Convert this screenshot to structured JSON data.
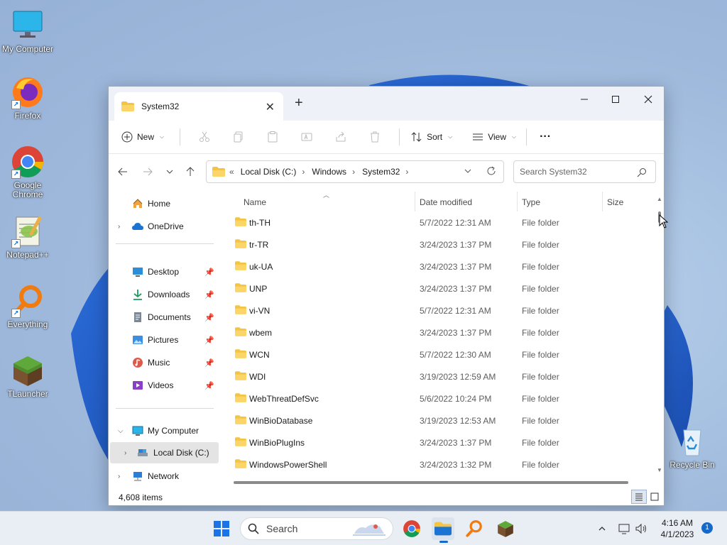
{
  "desktop": {
    "icons": [
      {
        "label": "My Computer"
      },
      {
        "label": "Firefox"
      },
      {
        "label": "Google Chrome"
      },
      {
        "label": "Notepad++"
      },
      {
        "label": "Everything"
      },
      {
        "label": "TLauncher"
      },
      {
        "label": "Recycle Bin"
      }
    ]
  },
  "window": {
    "tab_title": "System32",
    "toolbar": {
      "new_label": "New",
      "sort_label": "Sort",
      "view_label": "View",
      "more_label": "···"
    },
    "breadcrumb": {
      "overflow": "«",
      "items": [
        "Local Disk (C:)",
        "Windows",
        "System32"
      ]
    },
    "search_placeholder": "Search System32",
    "sidebar": {
      "home": "Home",
      "onedrive": "OneDrive",
      "pinned": [
        "Desktop",
        "Downloads",
        "Documents",
        "Pictures",
        "Music",
        "Videos"
      ],
      "my_computer": "My Computer",
      "local_disk": "Local Disk (C:)",
      "network": "Network"
    },
    "columns": {
      "name": "Name",
      "date": "Date modified",
      "type": "Type",
      "size": "Size"
    },
    "rows": [
      {
        "name": "th-TH",
        "date": "5/7/2022 12:31 AM",
        "type": "File folder"
      },
      {
        "name": "tr-TR",
        "date": "3/24/2023 1:37 PM",
        "type": "File folder"
      },
      {
        "name": "uk-UA",
        "date": "3/24/2023 1:37 PM",
        "type": "File folder"
      },
      {
        "name": "UNP",
        "date": "3/24/2023 1:37 PM",
        "type": "File folder"
      },
      {
        "name": "vi-VN",
        "date": "5/7/2022 12:31 AM",
        "type": "File folder"
      },
      {
        "name": "wbem",
        "date": "3/24/2023 1:37 PM",
        "type": "File folder"
      },
      {
        "name": "WCN",
        "date": "5/7/2022 12:30 AM",
        "type": "File folder"
      },
      {
        "name": "WDI",
        "date": "3/19/2023 12:59 AM",
        "type": "File folder"
      },
      {
        "name": "WebThreatDefSvc",
        "date": "5/6/2022 10:24 PM",
        "type": "File folder"
      },
      {
        "name": "WinBioDatabase",
        "date": "3/19/2023 12:53 AM",
        "type": "File folder"
      },
      {
        "name": "WinBioPlugIns",
        "date": "3/24/2023 1:37 PM",
        "type": "File folder"
      },
      {
        "name": "WindowsPowerShell",
        "date": "3/24/2023 1:32 PM",
        "type": "File folder"
      }
    ],
    "status": "4,608 items"
  },
  "taskbar": {
    "search_label": "Search",
    "time": "4:16 AM",
    "date": "4/1/2023",
    "notification_count": "1"
  },
  "colors": {
    "accent": "#1769c9",
    "folder": "#f4c443",
    "window_chrome": "#eef2f8"
  }
}
